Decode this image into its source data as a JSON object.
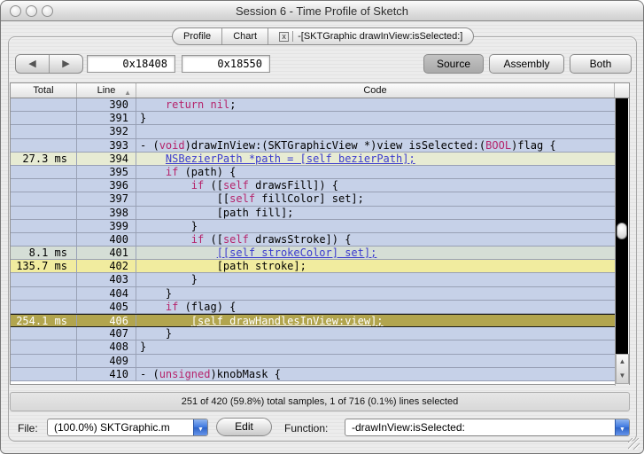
{
  "window": {
    "title": "Session 6 - Time Profile of Sketch",
    "traffic_lights": [
      "close",
      "minimize",
      "zoom"
    ]
  },
  "tabs": [
    {
      "label": "Profile"
    },
    {
      "label": "Chart"
    },
    {
      "label": "-[SKTGraphic drawInView:isSelected:]",
      "closable": true,
      "close_glyph": "x"
    }
  ],
  "toolbar": {
    "back_icon": "◀",
    "forward_icon": "▶",
    "address_start": "0x18408",
    "address_end": "0x18550",
    "view_buttons": [
      {
        "label": "Source",
        "selected": true
      },
      {
        "label": "Assembly",
        "selected": false
      },
      {
        "label": "Both",
        "selected": false
      }
    ]
  },
  "table": {
    "columns": {
      "total": "Total",
      "line": "Line",
      "code": "Code"
    },
    "sort_icon": "▲",
    "rows": [
      {
        "total": "",
        "line": "390",
        "hl": "",
        "segs": [
          [
            "    ",
            "p"
          ],
          [
            "return",
            "k"
          ],
          [
            " ",
            "p"
          ],
          [
            "nil",
            "k"
          ],
          [
            ";",
            "p"
          ]
        ]
      },
      {
        "total": "",
        "line": "391",
        "hl": "",
        "segs": [
          [
            "}",
            "p"
          ]
        ]
      },
      {
        "total": "",
        "line": "392",
        "hl": "",
        "segs": [
          [
            "",
            "p"
          ]
        ]
      },
      {
        "total": "",
        "line": "393",
        "hl": "",
        "segs": [
          [
            "- (",
            "p"
          ],
          [
            "void",
            "k"
          ],
          [
            ")drawInView:(SKTGraphicView *)view isSelected:(",
            "p"
          ],
          [
            "BOOL",
            "k"
          ],
          [
            ")flag {",
            "p"
          ]
        ]
      },
      {
        "total": "27.3 ms",
        "line": "394",
        "hl": "green",
        "segs": [
          [
            "    ",
            "p"
          ],
          [
            "NSBezierPath *path = [self bezierPath];",
            "l"
          ]
        ]
      },
      {
        "total": "",
        "line": "395",
        "hl": "",
        "segs": [
          [
            "    ",
            "p"
          ],
          [
            "if",
            "k"
          ],
          [
            " (path) {",
            "p"
          ]
        ]
      },
      {
        "total": "",
        "line": "396",
        "hl": "",
        "segs": [
          [
            "        ",
            "p"
          ],
          [
            "if",
            "k"
          ],
          [
            " ([",
            "p"
          ],
          [
            "self",
            "k"
          ],
          [
            " drawsFill]) {",
            "p"
          ]
        ]
      },
      {
        "total": "",
        "line": "397",
        "hl": "",
        "segs": [
          [
            "            [[",
            "p"
          ],
          [
            "self",
            "k"
          ],
          [
            " fillColor] set];",
            "p"
          ]
        ]
      },
      {
        "total": "",
        "line": "398",
        "hl": "",
        "segs": [
          [
            "            [path fill];",
            "p"
          ]
        ]
      },
      {
        "total": "",
        "line": "399",
        "hl": "",
        "segs": [
          [
            "        }",
            "p"
          ]
        ]
      },
      {
        "total": "",
        "line": "400",
        "hl": "",
        "segs": [
          [
            "        ",
            "p"
          ],
          [
            "if",
            "k"
          ],
          [
            " ([",
            "p"
          ],
          [
            "self",
            "k"
          ],
          [
            " drawsStroke]) {",
            "p"
          ]
        ]
      },
      {
        "total": "8.1 ms",
        "line": "401",
        "hl": "graygreen",
        "segs": [
          [
            "            ",
            "p"
          ],
          [
            "[[self strokeColor] set];",
            "l"
          ]
        ]
      },
      {
        "total": "135.7 ms",
        "line": "402",
        "hl": "yellow",
        "segs": [
          [
            "            [path stroke];",
            "p"
          ]
        ]
      },
      {
        "total": "",
        "line": "403",
        "hl": "",
        "segs": [
          [
            "        }",
            "p"
          ]
        ]
      },
      {
        "total": "",
        "line": "404",
        "hl": "",
        "segs": [
          [
            "    }",
            "p"
          ]
        ]
      },
      {
        "total": "",
        "line": "405",
        "hl": "",
        "segs": [
          [
            "    ",
            "p"
          ],
          [
            "if",
            "k"
          ],
          [
            " (flag) {",
            "p"
          ]
        ]
      },
      {
        "total": "254.1 ms",
        "line": "406",
        "hl": "sel",
        "segs": [
          [
            "        ",
            "p"
          ],
          [
            "[self drawHandlesInView:view];",
            "l"
          ]
        ]
      },
      {
        "total": "",
        "line": "407",
        "hl": "",
        "segs": [
          [
            "    }",
            "p"
          ]
        ]
      },
      {
        "total": "",
        "line": "408",
        "hl": "",
        "segs": [
          [
            "}",
            "p"
          ]
        ]
      },
      {
        "total": "",
        "line": "409",
        "hl": "",
        "segs": [
          [
            "",
            "p"
          ]
        ]
      },
      {
        "total": "",
        "line": "410",
        "hl": "",
        "segs": [
          [
            "- (",
            "p"
          ],
          [
            "unsigned",
            "k"
          ],
          [
            ")knobMask {",
            "p"
          ]
        ]
      }
    ]
  },
  "scrollbar": {
    "up_icon": "▲",
    "down_icon": "▼"
  },
  "status": {
    "text": "251 of 420 (59.8%) total samples, 1 of 716 (0.1%) lines selected"
  },
  "footer": {
    "file_label": "File:",
    "file_value": "(100.0%) SKTGraphic.m",
    "edit_label": "Edit",
    "function_label": "Function:",
    "function_value": "-drawInView:isSelected:",
    "dropdown_icon": "▼"
  },
  "colors": {
    "row_blue": "#c6d1e8",
    "row_green": "#e7ebd3",
    "row_graygreen": "#d5ded6",
    "row_yellow": "#f1ec9f",
    "row_selected": "#b2a54e",
    "keyword": "#b5246b",
    "link": "#3b3bce",
    "popup_blue": "#3f79e0",
    "scroll_track": "#000000"
  }
}
